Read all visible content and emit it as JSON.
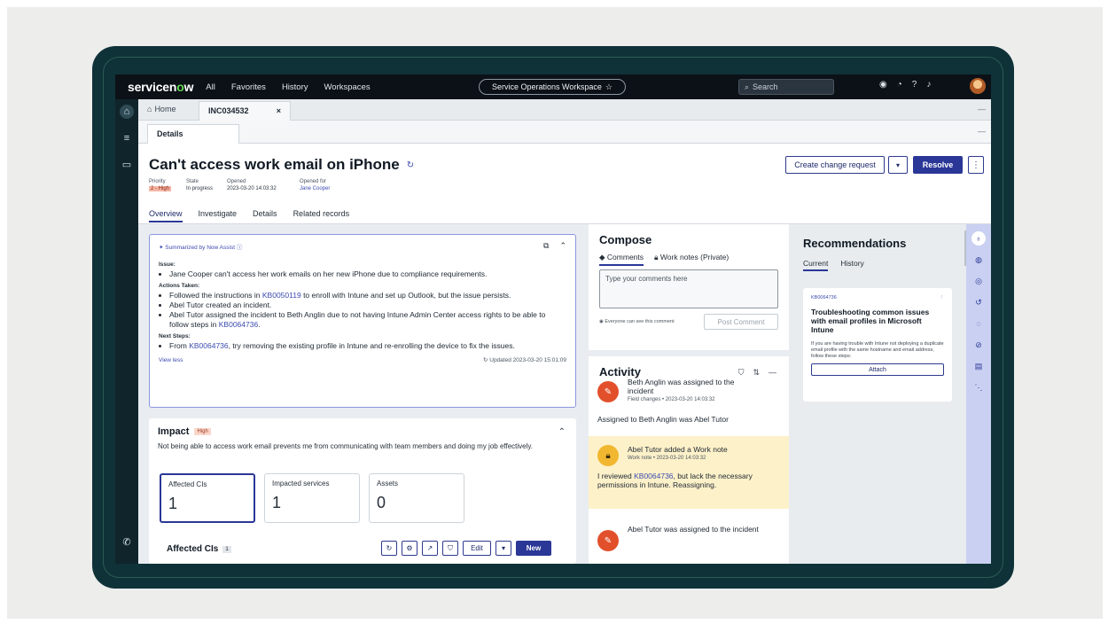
{
  "topbar": {
    "logo_pre": "servicen",
    "logo_o": "o",
    "logo_post": "w",
    "nav": [
      "All",
      "Favorites",
      "History",
      "Workspaces"
    ],
    "workspace": "Service Operations Workspace",
    "search_placeholder": "Search"
  },
  "tabs": {
    "home": "Home",
    "incident": "INC034532",
    "close": "×",
    "subtab": "Details"
  },
  "header": {
    "title": "Can't access work email on iPhone",
    "actions": {
      "change": "Create change request",
      "resolve": "Resolve"
    },
    "meta": {
      "priority_label": "Priority",
      "priority_value": "2 - High",
      "state_label": "State",
      "state_value": "In progress",
      "opened_label": "Opened",
      "opened_value": "2023-03-20 14:03:32",
      "opened_for_label": "Opened for",
      "opened_for_value": "Jane Cooper"
    },
    "tabs": [
      "Overview",
      "Investigate",
      "Details",
      "Related records"
    ]
  },
  "summary": {
    "tag": "Summarized by Now Assist",
    "issue_label": "Issue:",
    "issue_text": "Jane Cooper can't access her work emails on her new iPhone due to compliance requirements.",
    "actions_label": "Actions Taken:",
    "action1_pre": "Followed the instructions in ",
    "action1_kb": "KB0050119",
    "action1_post": " to enroll with Intune and set up Outlook, but the issue persists.",
    "action2": "Abel Tutor created an incident.",
    "action3_pre": "Abel Tutor assigned the incident to Beth Anglin due to not having Intune Admin Center access rights to be able to follow steps in ",
    "action3_kb": "KB0064736",
    "action3_post": ".",
    "next_label": "Next Steps:",
    "next_pre": "From ",
    "next_kb": "KB0064736",
    "next_post": ", try removing the existing profile in Intune and re-enrolling the device to fix the issues.",
    "view_less": "View less",
    "updated": "Updated 2023-03-20 15:01:09"
  },
  "impact": {
    "title": "Impact",
    "badge": "High",
    "description": "Not being able to access work email prevents me from communicating with team members and doing my job effectively.",
    "cards": [
      {
        "label": "Affected CIs",
        "value": "1"
      },
      {
        "label": "Impacted services",
        "value": "1"
      },
      {
        "label": "Assets",
        "value": "0"
      }
    ],
    "affected_title": "Affected CIs",
    "affected_count": "1",
    "edit": "Edit",
    "new": "New"
  },
  "compose": {
    "title": "Compose",
    "tab_comments": "Comments",
    "tab_worknotes": "Work notes (Private)",
    "placeholder": "Type your comments here",
    "note": "Everyone can see this comment",
    "post": "Post Comment"
  },
  "activity": {
    "title": "Activity",
    "items": [
      {
        "head": "Beth Anglin was assigned to the incident",
        "sub": "Field changes • 2023-03-20 14:03:32",
        "body": "Assigned to  Beth Anglin was Abel Tutor"
      },
      {
        "head": "Abel Tutor added a Work note",
        "sub": "Work note • 2023-03-20 14:03:32",
        "body_pre": "I reviewed ",
        "body_kb": "KB0064736",
        "body_post": ", but lack the necessary permissions in Intune. Reassigning."
      },
      {
        "head": "Abel Tutor was assigned to the incident"
      }
    ]
  },
  "recommendations": {
    "title": "Recommendations",
    "tab_current": "Current",
    "tab_history": "History",
    "card": {
      "kb": "KB0064736",
      "title": "Troubleshooting common issues with email profiles in Microsoft Intune",
      "desc": "If you are having trouble with Intune not deploying a duplicate email profile with the same hostname and email address, follow these steps:",
      "attach": "Attach"
    }
  }
}
